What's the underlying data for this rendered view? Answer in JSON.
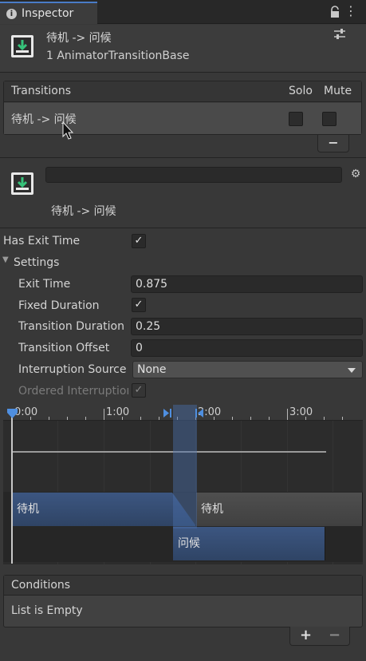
{
  "tab": {
    "label": "Inspector",
    "info_glyph": "i"
  },
  "header": {
    "title": "待机 -> 问候",
    "subtitle": "1 AnimatorTransitionBase"
  },
  "transitions": {
    "header": "Transitions",
    "col_solo": "Solo",
    "col_mute": "Mute",
    "rows": [
      {
        "label": "待机 -> 问候",
        "solo": false,
        "mute": false
      }
    ],
    "remove_label": "−"
  },
  "transition": {
    "name_value": "",
    "caption": "待机 -> 问候"
  },
  "properties": {
    "has_exit_time": {
      "label": "Has Exit Time",
      "checked": true
    },
    "settings_label": "Settings",
    "exit_time": {
      "label": "Exit Time",
      "value": "0.875"
    },
    "fixed_duration": {
      "label": "Fixed Duration",
      "checked": true
    },
    "transition_duration": {
      "label": "Transition Duration",
      "value": "0.25"
    },
    "transition_offset": {
      "label": "Transition Offset",
      "value": "0"
    },
    "interruption_source": {
      "label": "Interruption Source",
      "value": "None"
    },
    "ordered_interruption": {
      "label": "Ordered Interruption",
      "checked": true
    }
  },
  "timeline": {
    "ticks": [
      "0:00",
      "1:00",
      "2:00",
      "3:00"
    ],
    "source_clip": "待机",
    "source_clip_after": "待机",
    "dest_clip": "问候"
  },
  "conditions": {
    "header": "Conditions",
    "empty_text": "List is Empty",
    "add_label": "+",
    "remove_label": "−"
  },
  "colors": {
    "accent": "#4a7cc7",
    "clip_blue": "#3c5681",
    "background": "#383838"
  }
}
